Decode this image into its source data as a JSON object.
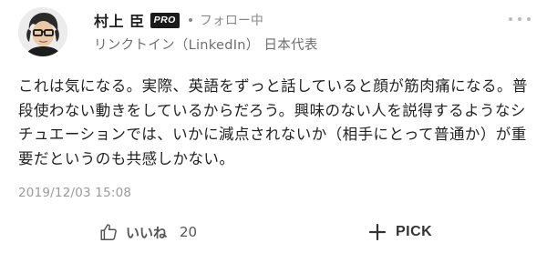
{
  "author": {
    "name": "村上 臣",
    "badge": "PRO",
    "follow_status": "フォロー中",
    "title": "リンクトイン（LinkedIn） 日本代表",
    "avatar_icon": "user-avatar-icon"
  },
  "comment": {
    "text": "これは気になる。実際、英語をずっと話していると顔が筋肉痛になる。普段使わない動きをしているからだろう。興味のない人を説得するようなシチュエーションでは、いかに減点されないか（相手にとって普通か）が重要だというのも共感しかない。",
    "timestamp": "2019/12/03 15:08"
  },
  "actions": {
    "like_label": "いいね",
    "like_count": "20",
    "like_icon": "thumbs-up-icon",
    "pick_label": "PICK",
    "pick_icon": "plus-icon"
  },
  "menu": {
    "more_icon": "more-options-icon"
  },
  "colors": {
    "text": "#222222",
    "muted": "#8a8a8a",
    "badge_bg": "#1a1a1a",
    "timestamp": "#9a9a9a"
  }
}
